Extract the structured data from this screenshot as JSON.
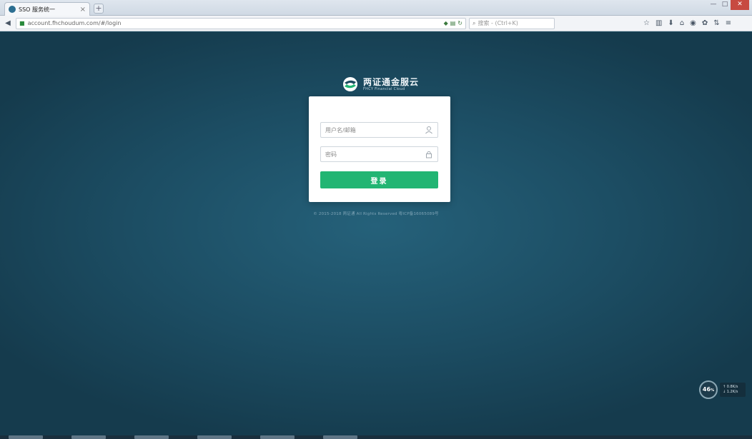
{
  "browser": {
    "tab_title": "SSO 服务统一",
    "tab_close": "×",
    "new_tab": "+",
    "window_title": "",
    "url": "account.fhchoudum.com/#/login",
    "search_placeholder": "搜索 - (Ctrl+K)",
    "window_controls": [
      "—",
      "□",
      "✕"
    ]
  },
  "page": {
    "logo_title": "两证通金服云",
    "logo_sub": "FHCY Financial Cloud",
    "username_placeholder": "用户名/邮箱",
    "password_placeholder": "密码",
    "login_button": "登录",
    "copyright": "© 2015-2018 两证通 All Rights Reserved 粤ICP备16065089号"
  },
  "widget": {
    "speed_value": "46",
    "speed_unit": "%",
    "line1": "↑ 0.8K/s",
    "line2": "↓ 1.2K/s"
  },
  "colors": {
    "background": "#1b4a5e",
    "accent_green": "#22b573",
    "card": "#ffffff"
  }
}
